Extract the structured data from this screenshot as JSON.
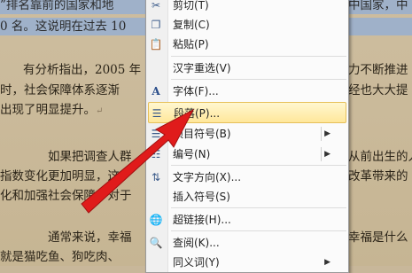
{
  "document": {
    "lines": [
      {
        "text": "”排名靠前的国家和地",
        "selected": true
      },
      {
        "text": "0 名。这说明在过去 10",
        "selected": true
      },
      {
        "text": "有分析指出，2005 年",
        "selected": false
      },
      {
        "text": "时，社会保障体系逐渐",
        "selected": false
      },
      {
        "text": "出现了明显提升。",
        "selected": false
      },
      {
        "text": "如果把调查人群",
        "selected": false
      },
      {
        "text": "指数变化更加明显，这",
        "selected": false
      },
      {
        "text": "化和加强社会保障，对于",
        "selected": false
      },
      {
        "text": "通常来说，幸福",
        "selected": false
      },
      {
        "text": "就是猫吃鱼、狗吃肉、",
        "selected": false
      }
    ],
    "right_lines": [
      {
        "text": "中国家，中",
        "selected": true
      },
      {
        "text": "力不断推进",
        "selected": false
      },
      {
        "text": "经也大大提",
        "selected": false
      },
      {
        "text": "从前出生的人",
        "selected": false
      },
      {
        "text": "改革带来的",
        "selected": false
      },
      {
        "text": "幸福是什么",
        "selected": false
      }
    ],
    "paragraph_mark": "↵"
  },
  "menu": {
    "items": [
      {
        "label": "剪切(T)",
        "icon": "cut-icon",
        "glyph": "✂"
      },
      {
        "label": "复制(C)",
        "icon": "copy-icon",
        "glyph": "❐"
      },
      {
        "label": "粘贴(P)",
        "icon": "paste-icon",
        "glyph": "📋"
      },
      {
        "label": "汉字重选(V)",
        "icon": "",
        "glyph": ""
      },
      {
        "label": "字体(F)...",
        "icon": "font-icon",
        "glyph": "A"
      },
      {
        "label": "段落(P)...",
        "icon": "paragraph-icon",
        "glyph": "☰",
        "highlighted": true
      },
      {
        "label": "项目符号(B)",
        "icon": "bullets-icon",
        "glyph": "☰",
        "submenu": true
      },
      {
        "label": "编号(N)",
        "icon": "numbering-icon",
        "glyph": "☷",
        "submenu": true
      },
      {
        "label": "文字方向(X)...",
        "icon": "text-direction-icon",
        "glyph": "⇅"
      },
      {
        "label": "插入符号(S)",
        "icon": "",
        "glyph": ""
      },
      {
        "label": "超链接(H)...",
        "icon": "hyperlink-icon",
        "glyph": "🌐"
      },
      {
        "label": "查阅(K)...",
        "icon": "lookup-icon",
        "glyph": "🔍"
      },
      {
        "label": "同义词(Y)",
        "icon": "",
        "glyph": "",
        "submenu": true
      }
    ],
    "submenu_arrow": "▶"
  },
  "colors": {
    "arrow": "#e01b1b",
    "highlight": "#ffe79a",
    "selection": "#9fb1c9"
  }
}
